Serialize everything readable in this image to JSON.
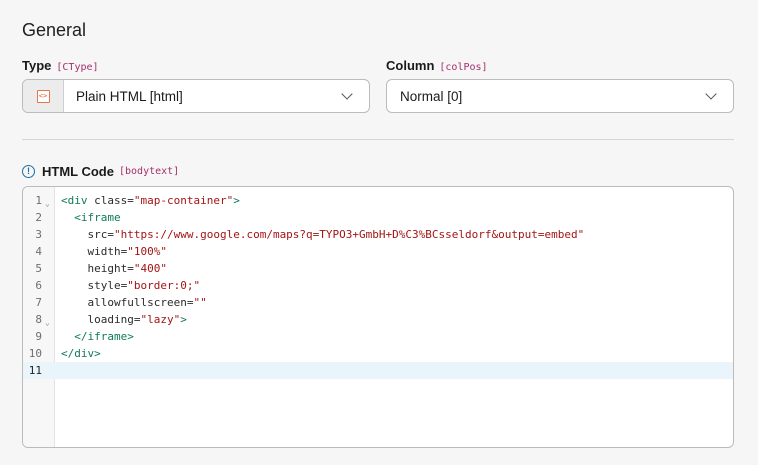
{
  "section": {
    "title": "General"
  },
  "type_field": {
    "label": "Type",
    "key": "[CType]",
    "value": "Plain HTML [html]",
    "icon": "html-code-icon"
  },
  "column_field": {
    "label": "Column",
    "key": "[colPos]",
    "value": "Normal [0]"
  },
  "code_field": {
    "label": "HTML Code",
    "key": "[bodytext]",
    "lines": [
      {
        "num": "1",
        "parts": [
          [
            "tag",
            "<div"
          ],
          [
            "attr",
            " class="
          ],
          [
            "str",
            "\"map-container\""
          ],
          [
            "tag",
            ">"
          ]
        ]
      },
      {
        "num": "2",
        "parts": [
          [
            "plain",
            "  "
          ],
          [
            "tag",
            "<iframe"
          ]
        ]
      },
      {
        "num": "3",
        "parts": [
          [
            "plain",
            "    "
          ],
          [
            "attr",
            "src="
          ],
          [
            "str",
            "\"https://www.google.com/maps?q=TYPO3+GmbH+D%C3%BCsseldorf&output=embed\""
          ]
        ]
      },
      {
        "num": "4",
        "parts": [
          [
            "plain",
            "    "
          ],
          [
            "attr",
            "width="
          ],
          [
            "str",
            "\"100%\""
          ]
        ]
      },
      {
        "num": "5",
        "parts": [
          [
            "plain",
            "    "
          ],
          [
            "attr",
            "height="
          ],
          [
            "str",
            "\"400\""
          ]
        ]
      },
      {
        "num": "6",
        "parts": [
          [
            "plain",
            "    "
          ],
          [
            "attr",
            "style="
          ],
          [
            "str",
            "\"border:0;\""
          ]
        ]
      },
      {
        "num": "7",
        "parts": [
          [
            "plain",
            "    "
          ],
          [
            "attr",
            "allowfullscreen="
          ],
          [
            "str",
            "\"\""
          ]
        ]
      },
      {
        "num": "8",
        "parts": [
          [
            "plain",
            "    "
          ],
          [
            "attr",
            "loading="
          ],
          [
            "str",
            "\"lazy\""
          ],
          [
            "tag",
            ">"
          ]
        ]
      },
      {
        "num": "9",
        "parts": [
          [
            "plain",
            "  "
          ],
          [
            "tag",
            "</iframe>"
          ]
        ]
      },
      {
        "num": "10",
        "parts": [
          [
            "tag",
            "</div>"
          ]
        ]
      },
      {
        "num": "11",
        "parts": []
      }
    ]
  }
}
